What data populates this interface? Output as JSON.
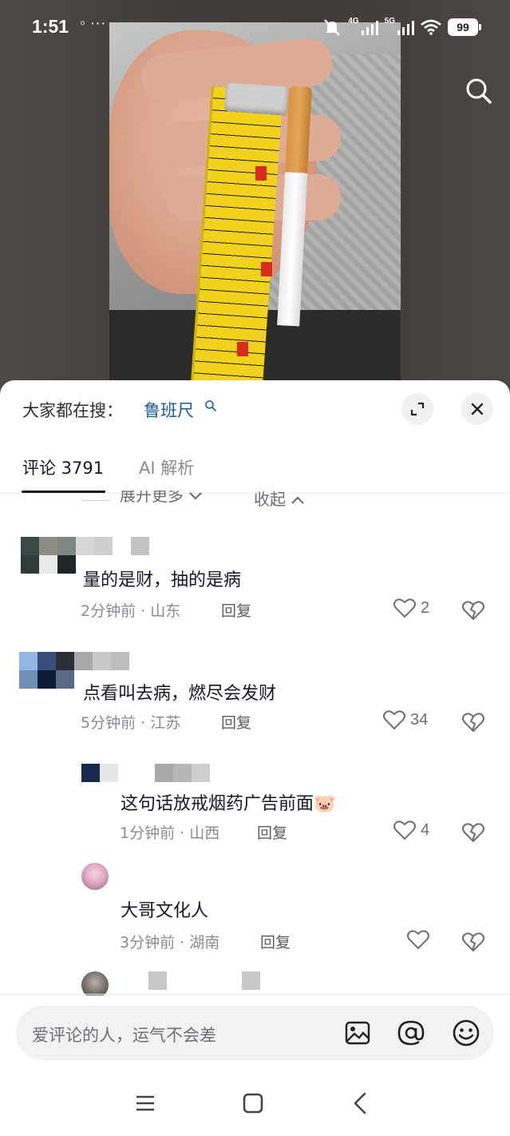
{
  "status_bar": {
    "time": "1:51",
    "dots": "◦ ···",
    "network_1": "4G",
    "network_2": "5G",
    "battery": "99"
  },
  "search_bar": {
    "prefix": "大家都在搜：",
    "term": "鲁班尺"
  },
  "tabs": {
    "comments_label": "评论 3791",
    "ai_label": "AI 解析"
  },
  "collapse_row": {
    "expand_more": "展开更多",
    "collapse": "收起"
  },
  "comments": [
    {
      "text": "量的是财，抽的是病",
      "time": "2分钟前",
      "location": "山东",
      "reply_label": "回复",
      "likes": "2"
    },
    {
      "text": "点看叫去病，燃尽会发财",
      "time": "5分钟前",
      "location": "江苏",
      "reply_label": "回复",
      "likes": "34"
    },
    {
      "text": "这句话放戒烟药广告前面🐷",
      "time": "1分钟前",
      "location": "山西",
      "reply_label": "回复",
      "likes": "4"
    },
    {
      "text": "大哥文化人",
      "time": "3分钟前",
      "location": "湖南",
      "reply_label": "回复",
      "likes": ""
    }
  ],
  "input": {
    "placeholder": "爱评论的人，运气不会差"
  },
  "colors": {
    "link_blue": "#1a5aa6",
    "text_primary": "#161823",
    "text_secondary": "#8a8b91",
    "sheet_bg": "#ffffff",
    "tape_yellow": "#f2d21d"
  },
  "icons": [
    "search-icon",
    "expand-icon",
    "close-icon",
    "heart-icon",
    "broken-heart-icon",
    "image-icon",
    "at-icon",
    "emoji-icon",
    "menu-icon",
    "home-icon",
    "back-icon"
  ]
}
